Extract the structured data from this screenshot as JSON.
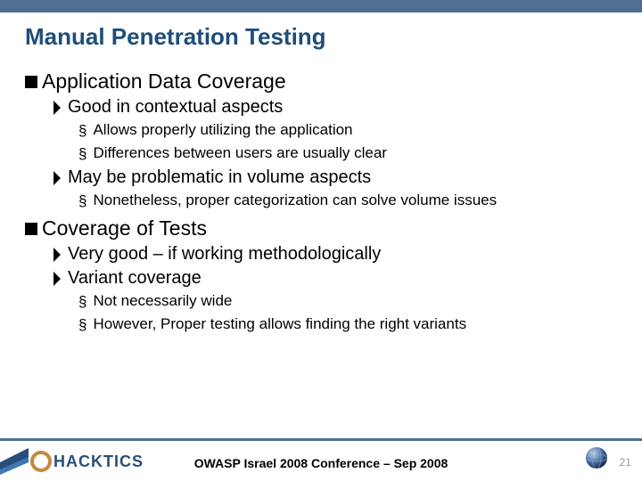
{
  "title": "Manual Penetration Testing",
  "sections": [
    {
      "heading": "Application Data Coverage",
      "items": [
        {
          "text": "Good in contextual aspects",
          "sub": [
            "Allows properly utilizing the application",
            "Differences between users are usually clear"
          ]
        },
        {
          "text": "May be problematic in volume aspects",
          "sub": [
            "Nonetheless, proper categorization can solve volume issues"
          ]
        }
      ]
    },
    {
      "heading": "Coverage of Tests",
      "items": [
        {
          "text": "Very good – if working methodologically",
          "sub": []
        },
        {
          "text": "Variant coverage",
          "sub": [
            "Not necessarily wide",
            "However, Proper testing allows finding the right variants"
          ]
        }
      ]
    }
  ],
  "footer": "OWASP Israel 2008 Conference – Sep 2008",
  "page": "21",
  "logo_text": "HACKTICS"
}
